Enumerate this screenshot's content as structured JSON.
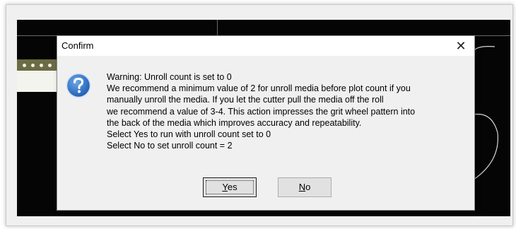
{
  "dialog": {
    "title": "Confirm",
    "close_glyph": "✕",
    "icon": "question-icon",
    "message_lines": [
      "Warning: Unroll count is set to 0",
      "We recommend a minimum value of 2 for unroll media before plot count if you",
      "manually unroll the media.  If you let the cutter pull the media off the roll",
      "we recommend a value of 3-4.  This action impresses the grit wheel pattern into",
      "the back of the media which improves accuracy and repeatability.",
      "Select Yes to run with unroll count set to 0",
      "Select No to set unroll count = 2"
    ],
    "yes_button": {
      "mnemonic": "Y",
      "rest": "es"
    },
    "no_button": {
      "mnemonic": "N",
      "rest": "o"
    }
  },
  "colors": {
    "canvas": "#050505",
    "dialog_bg": "#f0f0f0",
    "icon_blue": "#1f5fb4"
  }
}
